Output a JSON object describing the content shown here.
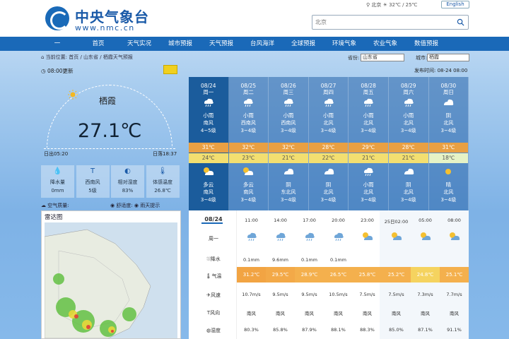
{
  "header": {
    "title": "中央气象台",
    "url": "www.nmc.cn",
    "toplinks": "⚲ 北京  ☀ 32℃ / 25℃",
    "english": "English",
    "search_placeholder": "北京"
  },
  "nav": [
    "一",
    "首页",
    "天气实况",
    "城市预报",
    "天气预报",
    "台风海洋",
    "全球预报",
    "环境气象",
    "农业气象",
    "数值预报"
  ],
  "breadcrumb": "⌂ 当前位置: 首页 / 山东省 / 栖霞天气预报",
  "selectors": {
    "province_label": "省份:",
    "province": "山东省",
    "city_label": "城市:",
    "city": "栖霞"
  },
  "publish_time": "发布时间: 08-24 08:00",
  "current": {
    "obs_time": "08:00更新",
    "station": "栖霞",
    "temperature": "27.1℃",
    "sunrise": "日出05:20",
    "sunset": "日落18:37",
    "boxes": [
      {
        "icon": "raindrop-icon",
        "label": "降水量",
        "value": "0mm"
      },
      {
        "icon": "wind-icon",
        "label": "西南风",
        "value": "5级"
      },
      {
        "icon": "humidity-icon",
        "label": "相对湿度",
        "value": "83%"
      },
      {
        "icon": "thermometer-icon",
        "label": "体感温度",
        "value": "26.8℃"
      }
    ],
    "aqi": "☁ 空气质量:",
    "aqi_right": "◉ 舒适度:  ◉ 雨天提示"
  },
  "radar": {
    "title": "雷达图"
  },
  "forecast": [
    {
      "date": "08/24",
      "week": "周一",
      "day_weather": "小雨",
      "day_wind": "南风",
      "day_level": "4~5级",
      "high": "31℃",
      "low": "24℃",
      "night_weather": "多云",
      "night_wind": "南风",
      "night_level": "3~4级",
      "active": true
    },
    {
      "date": "08/25",
      "week": "周二",
      "day_weather": "小雨",
      "day_wind": "西南风",
      "day_level": "3~4级",
      "high": "32℃",
      "low": "23℃",
      "night_weather": "多云",
      "night_wind": "南风",
      "night_level": "3~4级"
    },
    {
      "date": "08/26",
      "week": "周三",
      "day_weather": "小雨",
      "day_wind": "西南风",
      "day_level": "3~4级",
      "high": "32℃",
      "low": "21℃",
      "night_weather": "阴",
      "night_wind": "东北风",
      "night_level": "3~4级"
    },
    {
      "date": "08/27",
      "week": "周四",
      "day_weather": "小雨",
      "day_wind": "北风",
      "day_level": "3~4级",
      "high": "28℃",
      "low": "22℃",
      "night_weather": "阴",
      "night_wind": "北风",
      "night_level": "3~4级"
    },
    {
      "date": "08/28",
      "week": "周五",
      "day_weather": "小雨",
      "day_wind": "北风",
      "day_level": "3~4级",
      "high": "29℃",
      "low": "21℃",
      "night_weather": "小雨",
      "night_wind": "北风",
      "night_level": "3~4级"
    },
    {
      "date": "08/29",
      "week": "周六",
      "day_weather": "小雨",
      "day_wind": "北风",
      "day_level": "3~4级",
      "high": "28℃",
      "low": "21℃",
      "night_weather": "阴",
      "night_wind": "北风",
      "night_level": "3~4级"
    },
    {
      "date": "08/30",
      "week": "周日",
      "day_weather": "阴",
      "day_wind": "北风",
      "day_level": "3~4级",
      "high": "31℃",
      "low": "18℃",
      "night_weather": "晴",
      "night_wind": "北风",
      "night_level": "3~4级"
    }
  ],
  "hourly": {
    "date": "08/24",
    "week": "周一",
    "times": [
      "11:00",
      "14:00",
      "17:00",
      "20:00",
      "23:00",
      "25日02:00",
      "05:00",
      "08:00"
    ],
    "precip_label": "降水",
    "precip": [
      "0.1mm",
      "9.6mm",
      "0.1mm",
      "0.1mm",
      "",
      "",
      "",
      ""
    ],
    "temp_label": "气温",
    "temps": [
      "31.2℃",
      "29.5℃",
      "28.9℃",
      "26.5℃",
      "25.8℃",
      "25.2℃",
      "24.8℃",
      "25.1℃"
    ],
    "wind_speed_label": "风速",
    "wind_speeds": [
      "10.7m/s",
      "9.5m/s",
      "9.5m/s",
      "10.5m/s",
      "7.5m/s",
      "7.5m/s",
      "7.3m/s",
      "7.7m/s"
    ],
    "wind_dir_label": "风向",
    "wind_dirs": [
      "南风",
      "南风",
      "南风",
      "南风",
      "南风",
      "南风",
      "南风",
      "南风"
    ],
    "humidity_label": "湿度",
    "humidity": [
      "80.3%",
      "85.8%",
      "87.9%",
      "88.1%",
      "88.3%",
      "85.0%",
      "87.1%",
      "91.1%"
    ]
  },
  "colors": {
    "nav": "#1a69b8",
    "high_band": "#e9a043",
    "low_band": "#f3df70",
    "temp_row": "#f6b04a"
  }
}
